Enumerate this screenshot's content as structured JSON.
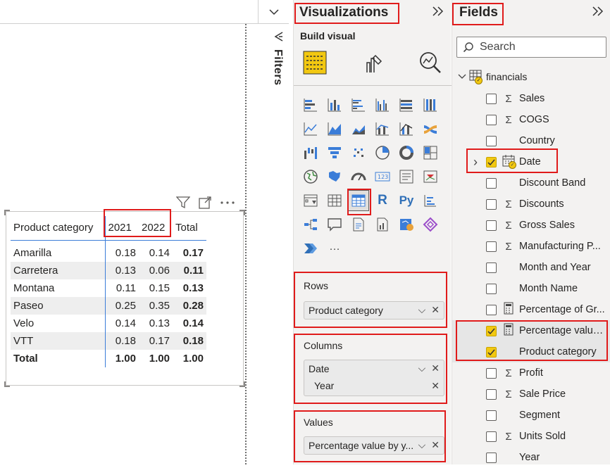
{
  "canvas": {
    "matrix": {
      "header": {
        "category": "Product category",
        "col1": "2021",
        "col2": "2022",
        "total": "Total"
      },
      "rows": [
        {
          "name": "Amarilla",
          "v1": "0.18",
          "v2": "0.14",
          "total": "0.17"
        },
        {
          "name": "Carretera",
          "v1": "0.13",
          "v2": "0.06",
          "total": "0.11"
        },
        {
          "name": "Montana",
          "v1": "0.11",
          "v2": "0.15",
          "total": "0.13"
        },
        {
          "name": "Paseo",
          "v1": "0.25",
          "v2": "0.35",
          "total": "0.28"
        },
        {
          "name": "Velo",
          "v1": "0.14",
          "v2": "0.13",
          "total": "0.14"
        },
        {
          "name": "VTT",
          "v1": "0.18",
          "v2": "0.17",
          "total": "0.18"
        }
      ],
      "total_row": {
        "name": "Total",
        "v1": "1.00",
        "v2": "1.00",
        "total": "1.00"
      }
    },
    "visual_header_icons": [
      "filter-icon",
      "focus-mode-icon",
      "more-options-icon"
    ]
  },
  "filters": {
    "label": "Filters"
  },
  "visualizations": {
    "title": "Visualizations",
    "build_visual": "Build visual",
    "rows_well": {
      "title": "Rows",
      "field": "Product category"
    },
    "columns_well": {
      "title": "Columns",
      "field": "Date",
      "subfield": "Year"
    },
    "values_well": {
      "title": "Values",
      "field": "Percentage value by y..."
    },
    "more_label": "···"
  },
  "fields": {
    "title": "Fields",
    "search_placeholder": "Search",
    "table_name": "financials",
    "items": [
      {
        "label": "Sales",
        "icon": "sigma",
        "checked": false
      },
      {
        "label": "COGS",
        "icon": "sigma",
        "checked": false
      },
      {
        "label": "Country",
        "icon": "",
        "checked": false
      },
      {
        "label": "Date",
        "icon": "calendar",
        "checked": true
      },
      {
        "label": "Discount Band",
        "icon": "",
        "checked": false
      },
      {
        "label": "Discounts",
        "icon": "sigma",
        "checked": false
      },
      {
        "label": "Gross Sales",
        "icon": "sigma",
        "checked": false
      },
      {
        "label": "Manufacturing P...",
        "icon": "sigma",
        "checked": false
      },
      {
        "label": "Month and Year",
        "icon": "",
        "checked": false
      },
      {
        "label": "Month Name",
        "icon": "",
        "checked": false
      },
      {
        "label": "Percentage of Gr...",
        "icon": "calculator",
        "checked": false
      },
      {
        "label": "Percentage value...",
        "icon": "calculator",
        "checked": true
      },
      {
        "label": "Product category",
        "icon": "",
        "checked": true
      },
      {
        "label": "Profit",
        "icon": "sigma",
        "checked": false
      },
      {
        "label": "Sale Price",
        "icon": "sigma",
        "checked": false
      },
      {
        "label": "Segment",
        "icon": "",
        "checked": false
      },
      {
        "label": "Units Sold",
        "icon": "sigma",
        "checked": false
      },
      {
        "label": "Year",
        "icon": "",
        "checked": false
      }
    ]
  },
  "colors": {
    "accent_yellow": "#f2c811",
    "highlight_red": "#e01b1b",
    "matrix_line_blue": "#3b7dd8",
    "pane_bg": "#f3f2f1"
  }
}
